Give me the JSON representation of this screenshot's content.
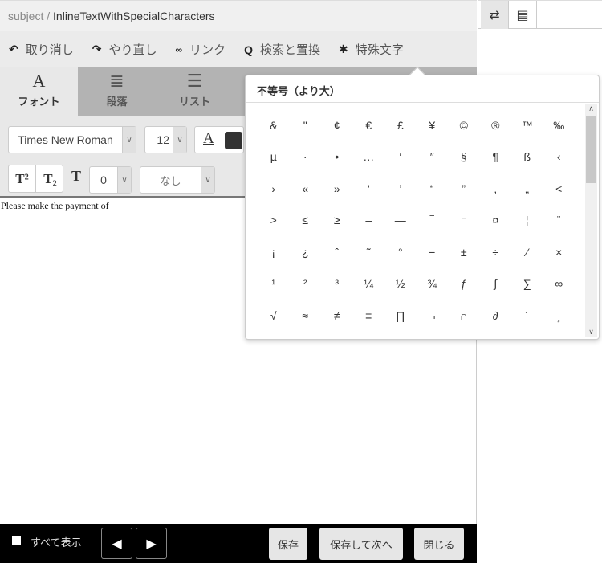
{
  "title": {
    "prefix": "subject /",
    "name": "InlineTextWithSpecialCharacters"
  },
  "toolbar": [
    {
      "icon": "↶",
      "label": "取り消し"
    },
    {
      "icon": "↷",
      "label": "やり直し"
    },
    {
      "icon": "🔗",
      "label": "リンク"
    },
    {
      "icon": "🔍",
      "label": "検索と置換"
    },
    {
      "icon": "✱",
      "label": "特殊文字"
    }
  ],
  "tabs": [
    {
      "icon": "A",
      "label": "フォント"
    },
    {
      "icon": "≣",
      "label": "段落"
    },
    {
      "icon": "☰",
      "label": "リスト"
    }
  ],
  "format": {
    "font": "Times New Roman",
    "size": "12",
    "spacing": "0",
    "decoration": "なし",
    "color": "#333333",
    "sup": "T²",
    "sub": "T₂",
    "underline_icon": "T"
  },
  "editor": {
    "text": "Please make the payment of"
  },
  "bottom": {
    "show_all": "すべて表示",
    "save": "保存",
    "save_next": "保存して次へ",
    "close": "閉じる",
    "prev": "◀",
    "next": "▶"
  },
  "popup": {
    "title": "不等号（より大）",
    "chars": [
      "&",
      "\"",
      "¢",
      "€",
      "£",
      "¥",
      "©",
      "®",
      "™",
      "‰",
      "µ",
      "·",
      "•",
      "…",
      "′",
      "″",
      "§",
      "¶",
      "ß",
      "‹",
      "›",
      "«",
      "»",
      "‘",
      "’",
      "“",
      "”",
      "‚",
      "„",
      "<",
      ">",
      "≤",
      "≥",
      "–",
      "—",
      "‾",
      "⁻",
      "¤",
      "¦",
      "¨",
      "¡",
      "¿",
      "ˆ",
      "˜",
      "°",
      "−",
      "±",
      "÷",
      "⁄",
      "×",
      "¹",
      "²",
      "³",
      "¼",
      "½",
      "¾",
      "ƒ",
      "∫",
      "∑",
      "∞",
      "√",
      "≈",
      "≠",
      "≡",
      "∏",
      "¬",
      "∩",
      "∂",
      "´",
      "¸"
    ]
  }
}
